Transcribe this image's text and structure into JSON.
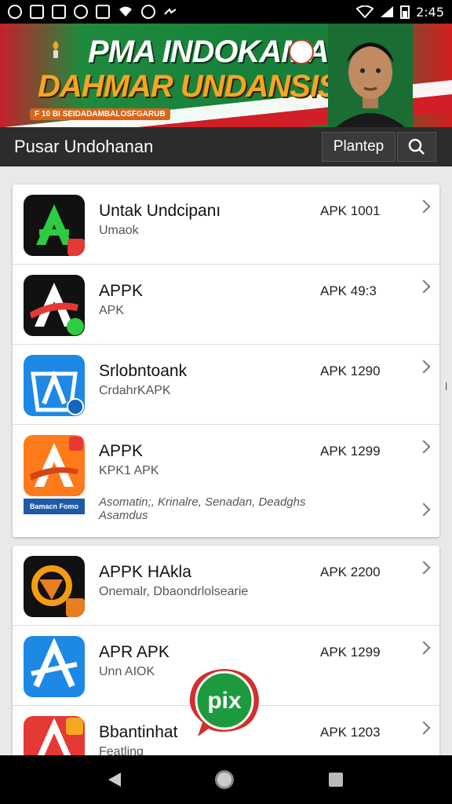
{
  "status_bar": {
    "time": "2:45",
    "left_icons": [
      "notification-icon",
      "square-icon",
      "image-icon",
      "sync-icon",
      "shield-icon",
      "wifi-icon",
      "settings-icon",
      "more-icon"
    ],
    "right_icons": [
      "wifi-icon",
      "signal-icon",
      "battery-icon"
    ]
  },
  "banner": {
    "title_line1": "PMA INDOKAMA",
    "title_line2": "DAHMAR UNDANSIS",
    "subtitle": "F 10 BI SEIDADAMBALOSFGARUB",
    "colors": {
      "green": "#1f8a3e",
      "red": "#d21e26",
      "orange": "#f5a623"
    }
  },
  "toolbar": {
    "title": "Pusar Undohanan",
    "action_label": "Plantep",
    "search_icon": "search-icon"
  },
  "list_group_1": [
    {
      "title": "Untak Undcipanı",
      "subtitle": "Umaok",
      "meta": "APK 1001",
      "icon_color": "#111111",
      "accent": "#2ecc40"
    },
    {
      "title": "APPK",
      "subtitle": "APK",
      "meta": "APK 49:3",
      "icon_color": "#111111",
      "accent": "#e53935"
    },
    {
      "title": "Srlobntoank",
      "subtitle": "CrdahrKAPK",
      "meta": "APK 1290",
      "icon_color": "#1e88e5",
      "accent": "#ffffff"
    },
    {
      "title": "APPK",
      "subtitle": "KPK1 APK",
      "meta": "APK 1299",
      "icon_color": "#ff7a1a",
      "accent": "#ffffff",
      "tags": "Asomatin;, Krinalre, Senadan, Deadghs Asamdus",
      "ribbon": "Bamacn Fomo"
    }
  ],
  "list_group_2": [
    {
      "title": "APPK HAkla",
      "subtitle": "Onemalr, Dbaondrlolsearie",
      "meta": "APK 2200",
      "icon_color": "#111111",
      "accent": "#f39c12"
    },
    {
      "title": "APR APK",
      "subtitle": "Unn AIOK",
      "meta": "APK 1299",
      "icon_color": "#1e88e5",
      "accent": "#ffffff"
    },
    {
      "title": "Bbantinhat",
      "subtitle": "Featling",
      "meta": "APK 1203",
      "icon_color": "#e53935",
      "accent": "#ffffff"
    }
  ],
  "fab": {
    "label": "pix",
    "color": "#1e9a3e"
  },
  "nav_bar": {
    "back": "back-icon",
    "home": "home-icon",
    "recents": "recents-icon"
  }
}
